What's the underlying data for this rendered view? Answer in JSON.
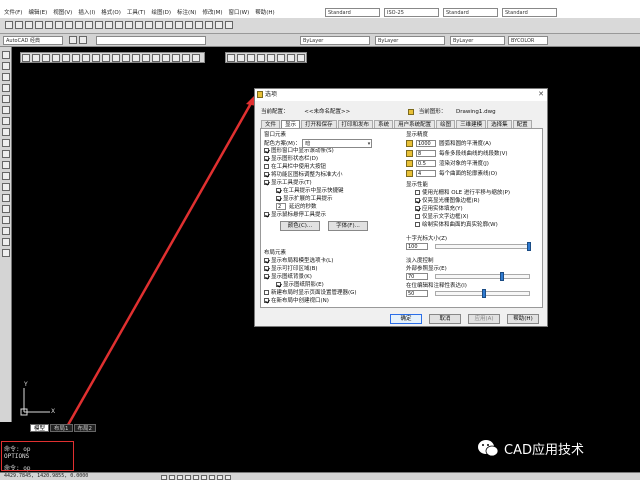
{
  "menubar": {
    "items": [
      "文件(F)",
      "编辑(E)",
      "视图(V)",
      "插入(I)",
      "格式(O)",
      "工具(T)",
      "绘图(D)",
      "标注(N)",
      "修改(M)",
      "窗口(W)",
      "帮助(H)"
    ],
    "combos": [
      "Standard",
      "ISO-25",
      "Standard",
      "Standard"
    ]
  },
  "toolbar2": {
    "workspace": "AutoCAD 经典",
    "layer": "ByLayer",
    "linetype": "ByLayer",
    "lineweight": "ByLayer",
    "color": "BYCOLOR"
  },
  "dialog": {
    "title": "选项",
    "current_profile_label": "当前配置：",
    "current_profile_value": "<<未命名配置>>",
    "current_drawing_label": "当前图形：",
    "current_drawing_value": "Drawing1.dwg",
    "tabs": [
      "文件",
      "显示",
      "打开和保存",
      "打印和发布",
      "系统",
      "用户系统配置",
      "绘图",
      "三维建模",
      "选择集",
      "配置"
    ],
    "active_tab": "显示",
    "window_elements": {
      "title": "窗口元素",
      "color_scheme_label": "配色方案(M)：",
      "color_scheme_value": "暗",
      "options": [
        {
          "label": "图形窗口中显示滚动条(S)",
          "checked": true
        },
        {
          "label": "显示图形状态栏(D)",
          "checked": true
        },
        {
          "label": "在工具栏中使用大按钮",
          "checked": false
        },
        {
          "label": "将功能区图标调整为标准大小",
          "checked": true
        },
        {
          "label": "显示工具提示(T)",
          "checked": true
        },
        {
          "label": "在工具提示中显示快捷键",
          "checked": true
        },
        {
          "label": "显示扩展的工具提示",
          "checked": true
        },
        {
          "label": "延迟的秒数",
          "checked": false
        },
        {
          "label": "显示鼠标悬停工具提示",
          "checked": true
        }
      ],
      "delay_value": "2",
      "colors_button": "颜色(C)...",
      "fonts_button": "字体(F)..."
    },
    "layout_elements": {
      "title": "布局元素",
      "options": [
        {
          "label": "显示布局和模型选项卡(L)",
          "checked": true
        },
        {
          "label": "显示可打印区域(B)",
          "checked": true
        },
        {
          "label": "显示图纸背景(K)",
          "checked": true
        },
        {
          "label": "显示图纸阴影(E)",
          "checked": true
        },
        {
          "label": "新建布局时显示页面设置管理器(G)",
          "checked": false
        },
        {
          "label": "在新布局中创建视口(N)",
          "checked": true
        }
      ]
    },
    "display_resolution": {
      "title": "显示精度",
      "items": [
        {
          "value": "1000",
          "label": "圆弧和圆的平滑度(A)"
        },
        {
          "value": "8",
          "label": "每条多段线曲线的线段数(V)"
        },
        {
          "value": "0.5",
          "label": "渲染对象的平滑度(J)"
        },
        {
          "value": "4",
          "label": "每个曲面的轮廓素线(O)"
        }
      ]
    },
    "display_performance": {
      "title": "显示性能",
      "options": [
        {
          "label": "使用光栅和 OLE 进行平移与缩放(P)",
          "checked": false
        },
        {
          "label": "仅亮显光栅图像边框(R)",
          "checked": true
        },
        {
          "label": "应用实体填充(Y)",
          "checked": true
        },
        {
          "label": "仅显示文字边框(X)",
          "checked": false
        },
        {
          "label": "绘制实体和曲面的真实轮廓(W)",
          "checked": false
        }
      ]
    },
    "crosshair": {
      "title": "十字光标大小(Z)",
      "value": "100",
      "fraction": 1.0
    },
    "fade_control": {
      "title": "淡入度控制",
      "xref_label": "外部参照显示(E)",
      "xref_value": "70",
      "xref_fraction": 0.7,
      "inplace_label": "在位编辑和注释性表达(I)",
      "inplace_value": "50",
      "inplace_fraction": 0.5
    },
    "buttons": {
      "ok": "确定",
      "cancel": "取消",
      "apply": "应用(A)",
      "help": "帮助(H)"
    }
  },
  "model_tabs": [
    "模型",
    "布局1",
    "布局2"
  ],
  "command": {
    "line1": "命令: op",
    "line2": "OPTIONS",
    "line3": "命令: op"
  },
  "status": {
    "coords": "4429.7845, 1420.9855, 0.0000"
  },
  "watermark": {
    "text": "CAD应用技术"
  },
  "ucs": {
    "y": "Y",
    "x": "X"
  },
  "colors": {
    "annotation": "#e03030",
    "dialog_bg": "#f0f0f0",
    "canvas": "#000000"
  }
}
